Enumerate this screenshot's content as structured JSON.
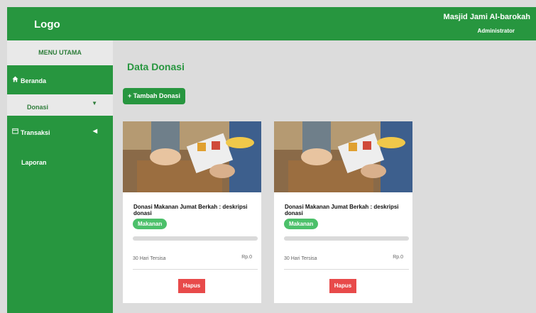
{
  "header": {
    "logo": "Logo",
    "org_name": "Masjid Jami Al-barokah",
    "role": "Administrator"
  },
  "sidebar": {
    "heading": "MENU UTAMA",
    "items": [
      {
        "label": "Beranda",
        "icon": "home-icon"
      },
      {
        "label": "Donasi",
        "icon": "chevron-down-icon"
      },
      {
        "label": "Transaksi",
        "icon": "calendar-icon"
      },
      {
        "label": "Laporan"
      }
    ]
  },
  "main": {
    "title": "Data Donasi",
    "add_button": "+ Tambah Donasi",
    "cards": [
      {
        "title": "Donasi Makanan Jumat Berkah : deskripsi donasi",
        "tag": "Makanan",
        "progress": 0,
        "remaining": "30 Hari Tersisa",
        "amount": "Rp.0",
        "delete_label": "Hapus"
      },
      {
        "title": "Donasi Makanan Jumat Berkah : deskripsi donasi",
        "tag": "Makanan",
        "progress": 0,
        "remaining": "30 Hari Tersisa",
        "amount": "Rp.0",
        "delete_label": "Hapus"
      }
    ]
  },
  "colors": {
    "primary": "#27963f",
    "tag": "#4cc06a",
    "danger": "#e84a4a",
    "background": "#dcdcdc"
  }
}
